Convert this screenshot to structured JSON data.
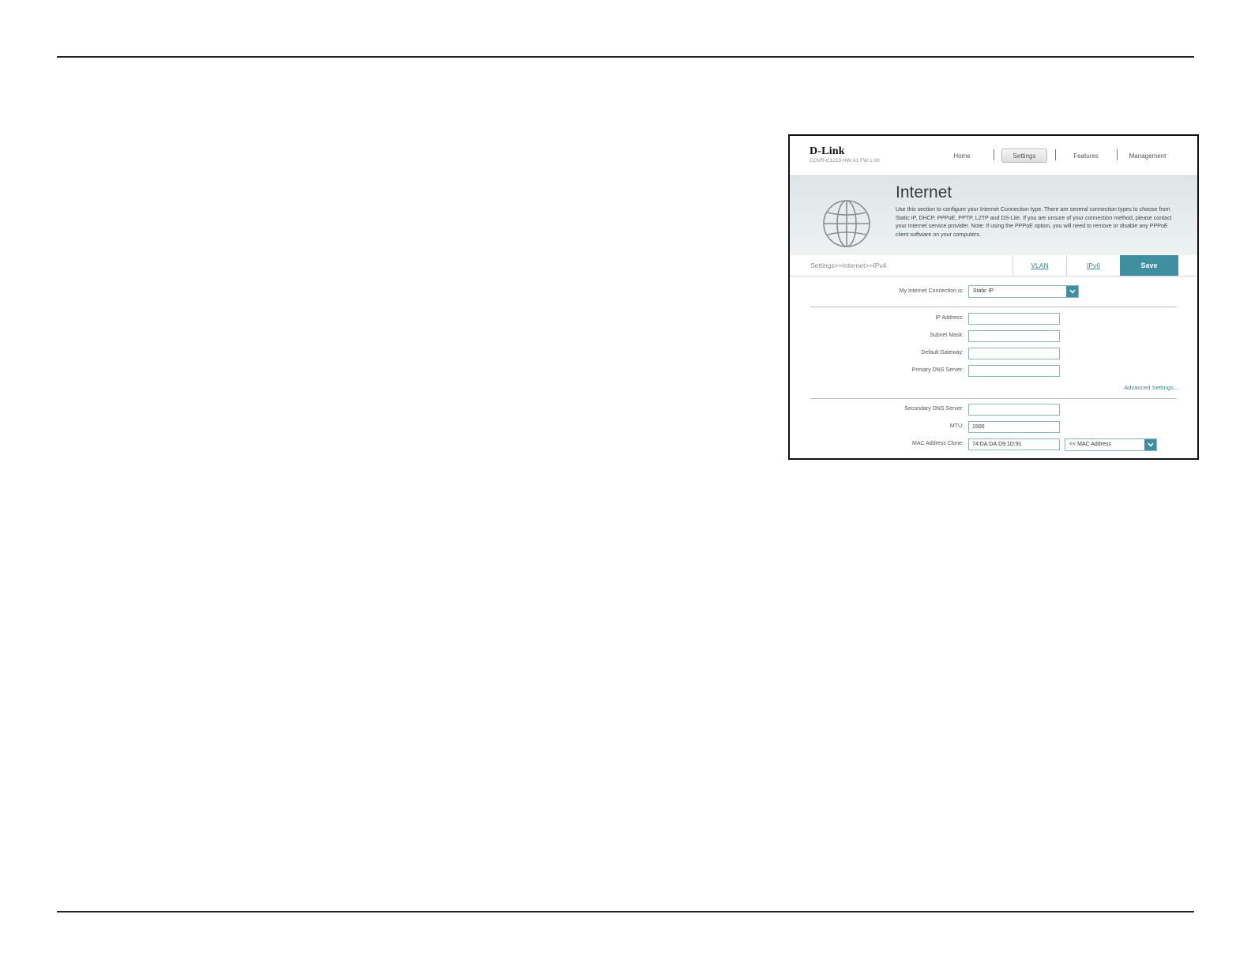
{
  "brand": {
    "logo": "D-Link",
    "hw_info": "COVR-C1210 HW:A1 FW:1.00"
  },
  "nav": {
    "home": "Home",
    "settings": "Settings",
    "features": "Features",
    "management": "Management"
  },
  "banner": {
    "title": "Internet",
    "description": "Use this section to configure your Internet Connection type. There are several connection types to choose from Static IP, DHCP, PPPoE, PPTP, L2TP and DS-Lite. If you are unsure of your connection method, please contact your Internet service provider. Note: If using the PPPoE option, you will need to remove or disable any PPPoE client software on your computers.",
    "icon": "globe-icon"
  },
  "breadcrumb": "Settings>>Internet>>IPv4",
  "tabs": {
    "vlan": "VLAN",
    "ipv6": "IPv6",
    "save": "Save"
  },
  "form": {
    "connection": {
      "label": "My Internet Connection is:",
      "value": "Static IP"
    },
    "ip_address": {
      "label": "IP Address:",
      "value": ""
    },
    "subnet_mask": {
      "label": "Subnet Mask:",
      "value": ""
    },
    "default_gateway": {
      "label": "Default Gateway:",
      "value": ""
    },
    "primary_dns": {
      "label": "Primary DNS Server:",
      "value": ""
    },
    "advanced_link": "Advanced Settings...",
    "secondary_dns": {
      "label": "Secondary DNS Server:",
      "value": ""
    },
    "mtu": {
      "label": "MTU:",
      "value": "1500"
    },
    "mac_clone": {
      "label": "MAC Address Clone:",
      "value": "74:DA:DA:D9:1D:91",
      "select": "<< MAC Address"
    }
  },
  "colors": {
    "accent": "#3f8fa1",
    "link": "#3e8796",
    "field_border": "#8fb5bc"
  }
}
